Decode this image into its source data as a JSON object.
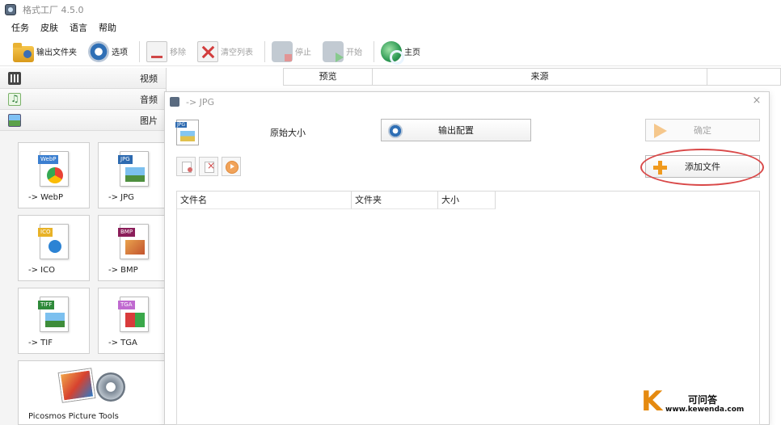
{
  "window": {
    "title": "格式工厂 4.5.0"
  },
  "menu": [
    "任务",
    "皮肤",
    "语言",
    "帮助"
  ],
  "toolbar": {
    "output_folder": "输出文件夹",
    "options": "选项",
    "remove": "移除",
    "clear_list": "清空列表",
    "stop": "停止",
    "start": "开始",
    "home": "主页"
  },
  "sidebar": {
    "categories": [
      "视频",
      "音频",
      "图片"
    ],
    "tiles": [
      {
        "tag": "WebP",
        "label": "-> WebP",
        "color": "#3b7fd0"
      },
      {
        "tag": "JPG",
        "label": "-> JPG",
        "color": "#2d6ab0"
      },
      {
        "tag": "ICO",
        "label": "-> ICO",
        "color": "#e8b227"
      },
      {
        "tag": "BMP",
        "label": "-> BMP",
        "color": "#8b1e5a"
      },
      {
        "tag": "TIFF",
        "label": "-> TIF",
        "color": "#2f8a3a"
      },
      {
        "tag": "TGA",
        "label": "-> TGA",
        "color": "#c06ad0"
      }
    ],
    "picosmos_label": "Picosmos Picture Tools"
  },
  "background_list": {
    "columns": [
      "预览",
      "来源"
    ]
  },
  "dialog": {
    "title": "-> JPG",
    "size_label": "原始大小",
    "output_config": "输出配置",
    "ok": "确定",
    "add_file": "添加文件",
    "columns": [
      "文件名",
      "文件夹",
      "大小"
    ]
  },
  "watermark": {
    "letter": "K",
    "site_name": "可问答",
    "url": "www.kewenda.com"
  },
  "colors": {
    "highlight": "#d94848",
    "accent_orange": "#f09a1e"
  }
}
